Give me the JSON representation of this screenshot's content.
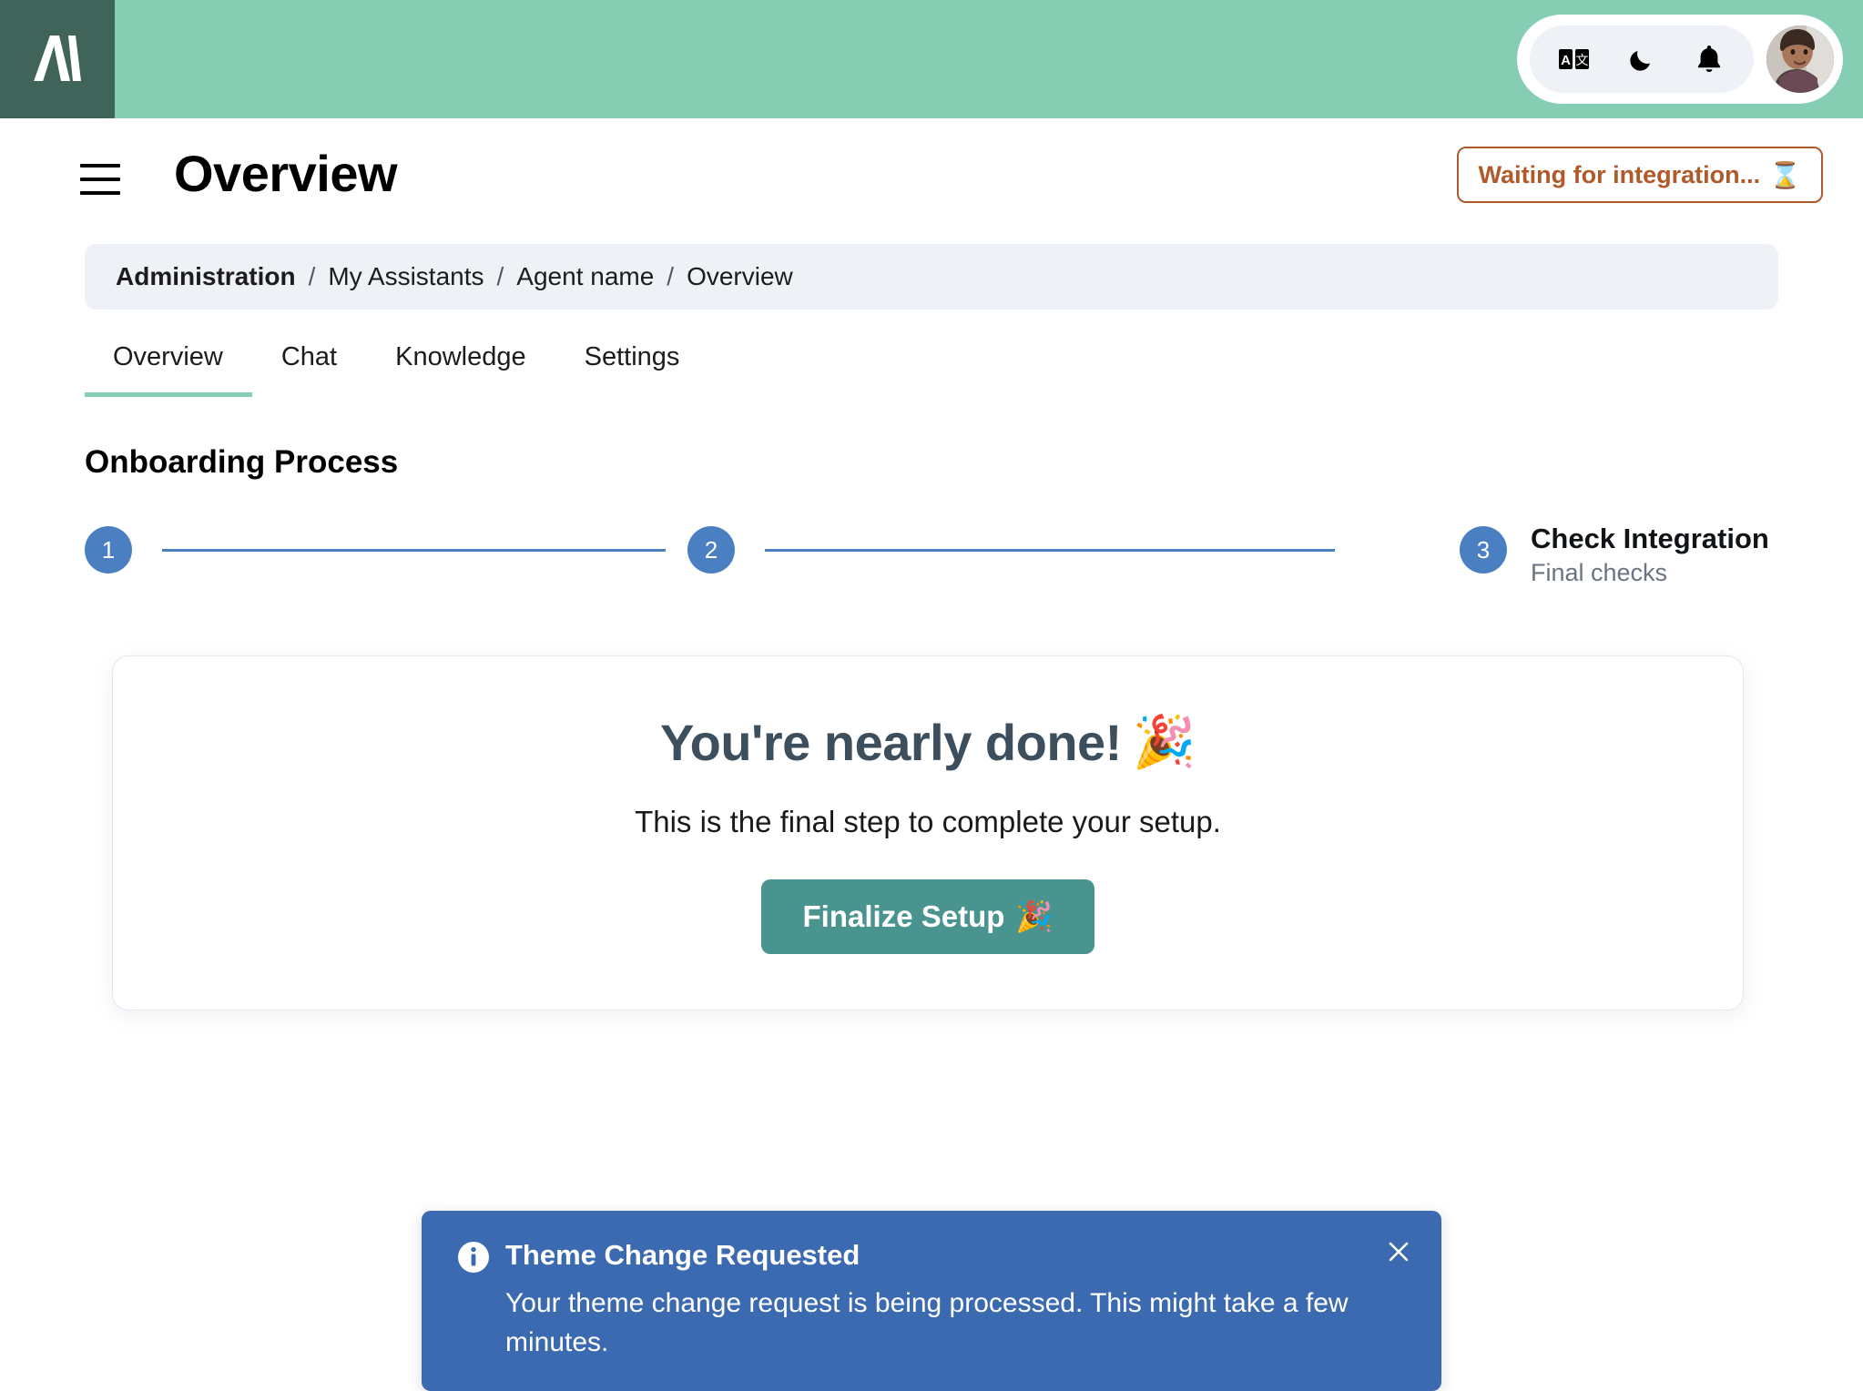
{
  "topbar": {
    "logo_name": "anthropic-style-logo",
    "actions": [
      {
        "name": "translate-icon",
        "glyph": "🔤",
        "label": "Translate"
      },
      {
        "name": "dark-mode-icon",
        "glyph": "🌙",
        "label": "Dark mode"
      },
      {
        "name": "notifications-icon",
        "glyph": "🔔",
        "label": "Notifications"
      }
    ],
    "avatar_label": "User avatar"
  },
  "header": {
    "menu_label": "Menu",
    "title": "Overview",
    "status_badge": {
      "text": "Waiting for integration...",
      "emoji": "⌛",
      "color": "#b05a2a"
    }
  },
  "breadcrumb": {
    "separator": "/",
    "items": [
      {
        "label": "Administration"
      },
      {
        "label": "My Assistants"
      },
      {
        "label": "Agent name"
      },
      {
        "label": "Overview"
      }
    ]
  },
  "tabs": {
    "active": "Overview",
    "items": [
      {
        "label": "Overview"
      },
      {
        "label": "Chat"
      },
      {
        "label": "Knowledge"
      },
      {
        "label": "Settings"
      }
    ],
    "active_color": "#85ceb4"
  },
  "onboarding": {
    "section_title": "Onboarding Process",
    "accent_color": "#4a7fc1",
    "steps": [
      {
        "number": "1",
        "title": "",
        "subtitle": ""
      },
      {
        "number": "2",
        "title": "",
        "subtitle": ""
      },
      {
        "number": "3",
        "title": "Check Integration",
        "subtitle": "Final checks"
      }
    ]
  },
  "card": {
    "title": "You're nearly done!",
    "title_emoji": "🎉",
    "subtitle": "This is the final step to complete your setup.",
    "button_label": "Finalize Setup",
    "button_emoji": "🎉",
    "button_color": "#4a9490"
  },
  "toast": {
    "icon_name": "info-icon",
    "title": "Theme Change Requested",
    "message": "Your theme change request is being processed. This might take a few minutes.",
    "close_label": "Close",
    "background_color": "#3c6ab0"
  },
  "theme": {
    "header_green": "#85ceb4",
    "logo_tile": "#41645a",
    "breadcrumb_bg": "#eef1f6"
  }
}
